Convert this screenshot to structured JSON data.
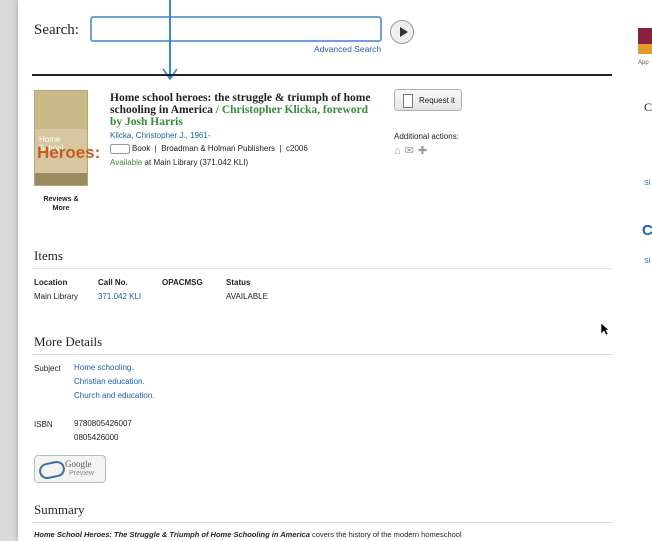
{
  "search": {
    "label": "Search:",
    "value": "",
    "advanced": "Advanced Search"
  },
  "record": {
    "title_main": "Home school heroes: the struggle & triumph of home schooling in America",
    "title_resp": " / Christopher Klicka, foreword by Josh Harris",
    "author": "Klicka, Christopher J., 1961-",
    "format": "Book",
    "publisher": "Broadman & Holman Publishers",
    "date": "c2006",
    "availability_status": "Available",
    "availability_rest": " at Main Library (371.042 KLI)",
    "reviews": "Reviews & More",
    "request_label": "Request it",
    "additional_actions": "Additional actions:",
    "cover": {
      "small": "Home School",
      "big": "Heroes:"
    }
  },
  "items": {
    "heading": "Items",
    "columns": [
      "Location",
      "Call No.",
      "OPACMSG",
      "Status"
    ],
    "rows": [
      [
        "Main Library",
        "371.042 KLI",
        "",
        "AVAILABLE"
      ]
    ]
  },
  "details": {
    "heading": "More Details",
    "subject_label": "Subject",
    "subjects": [
      "Home schooling.",
      "Christian education.",
      "Church and education."
    ],
    "isbn_label": "ISBN",
    "isbns": [
      "9780805426007",
      "0805426000"
    ],
    "google": {
      "g": "Google",
      "p": "Preview"
    }
  },
  "summary": {
    "heading": "Summary",
    "title": "Home School Heroes: The Struggle & Triumph of Home Schooling in America",
    "text": " covers the history of the modern homeschool"
  },
  "right_pane": {
    "app": "App",
    "c": "C",
    "s1": "Sl",
    "g": "C",
    "s2": "Sl"
  },
  "colors": {
    "link": "#1f5fa8",
    "title_green": "#3a8a3a",
    "annotation_arrow": "#3b86d6"
  }
}
